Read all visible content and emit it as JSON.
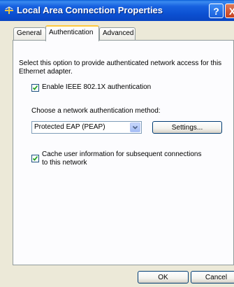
{
  "window": {
    "title": "Local Area Connection Properties",
    "help_glyph": "?",
    "close_glyph": "X"
  },
  "tabs": [
    {
      "label": "General",
      "active": false
    },
    {
      "label": "Authentication",
      "active": true
    },
    {
      "label": "Advanced",
      "active": false
    }
  ],
  "auth": {
    "description": "Select this option to provide authenticated network access for this Ethernet adapter.",
    "enable_8021x": {
      "label": "Enable IEEE 802.1X authentication",
      "checked": true
    },
    "method_label": "Choose a network authentication method:",
    "method_selected": "Protected EAP (PEAP)",
    "settings_label": "Settings...",
    "cache_user_info": {
      "label_line1": "Cache user information for subsequent connections",
      "label_line2": "to this network",
      "checked": true
    }
  },
  "buttons": {
    "ok": "OK",
    "cancel": "Cancel"
  },
  "colors": {
    "titlebar": "#0a4fd0",
    "dialog_bg": "#ece9d8",
    "panel_bg": "#fcfcfe",
    "active_tab_accent": "#ffc83c",
    "checkmark": "#21a121"
  },
  "icons": {
    "title": "network-connection-icon",
    "dropdown": "chevron-down-icon"
  }
}
